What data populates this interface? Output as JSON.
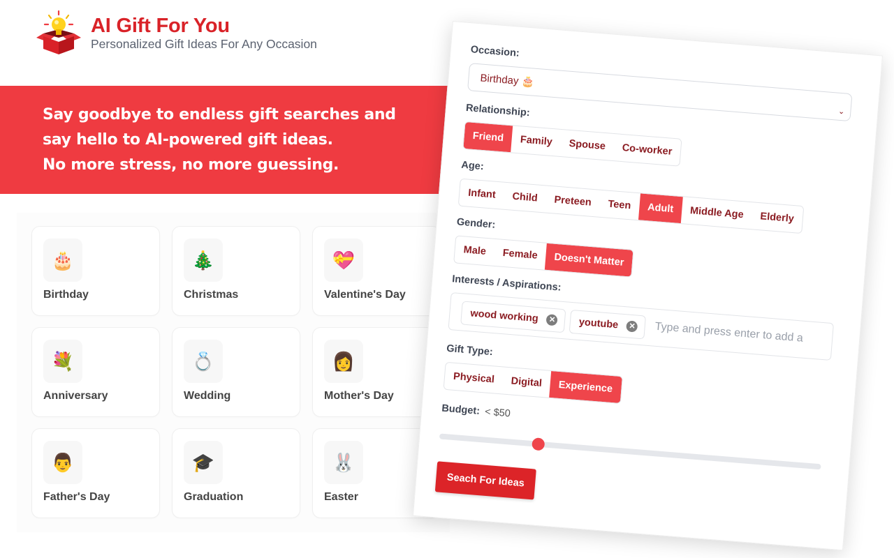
{
  "brand": {
    "title": "AI Gift For You",
    "subtitle": "Personalized Gift Ideas For Any Occasion",
    "logo_icon": "gift-box-lightbulb-icon",
    "accent_color": "#d92228"
  },
  "hero": {
    "lines": [
      "Say goodbye to endless gift searches and",
      "say hello to AI-powered gift ideas.",
      "No more stress, no more guessing."
    ],
    "background_color": "#ef3b41"
  },
  "occasions": [
    {
      "label": "Birthday",
      "emoji": "🎂",
      "icon": "birthday-cake-icon"
    },
    {
      "label": "Christmas",
      "emoji": "🎄",
      "icon": "christmas-tree-icon"
    },
    {
      "label": "Valentine's Day",
      "emoji": "💝",
      "icon": "heart-ribbon-icon"
    },
    {
      "label": "Anniversary",
      "emoji": "💐",
      "icon": "bouquet-icon"
    },
    {
      "label": "Wedding",
      "emoji": "💍",
      "icon": "ring-icon"
    },
    {
      "label": "Mother's Day",
      "emoji": "👩",
      "icon": "woman-icon"
    },
    {
      "label": "Father's Day",
      "emoji": "👨",
      "icon": "man-icon"
    },
    {
      "label": "Graduation",
      "emoji": "🎓",
      "icon": "graduation-cap-icon"
    },
    {
      "label": "Easter",
      "emoji": "🐰",
      "icon": "bunny-icon"
    }
  ],
  "form": {
    "occasion": {
      "label": "Occasion:",
      "value": "Birthday 🎂"
    },
    "relationship": {
      "label": "Relationship:",
      "options": [
        "Friend",
        "Family",
        "Spouse",
        "Co-worker"
      ],
      "selected": "Friend"
    },
    "age": {
      "label": "Age:",
      "options": [
        "Infant",
        "Child",
        "Preteen",
        "Teen",
        "Adult",
        "Middle Age",
        "Elderly"
      ],
      "selected": "Adult"
    },
    "gender": {
      "label": "Gender:",
      "options": [
        "Male",
        "Female",
        "Doesn't Matter"
      ],
      "selected": "Doesn't Matter"
    },
    "interests": {
      "label": "Interests / Aspirations:",
      "tags": [
        "wood working",
        "youtube"
      ],
      "placeholder": "Type and press enter to add a"
    },
    "gift_type": {
      "label": "Gift Type:",
      "options": [
        "Physical",
        "Digital",
        "Experience"
      ],
      "selected": "Experience"
    },
    "budget": {
      "label": "Budget:",
      "value_text": "< $50",
      "slider_fraction": 0.26
    },
    "submit_label": "Seach For Ideas",
    "active_color": "#ef454b",
    "option_text_color": "#8b1c22"
  }
}
